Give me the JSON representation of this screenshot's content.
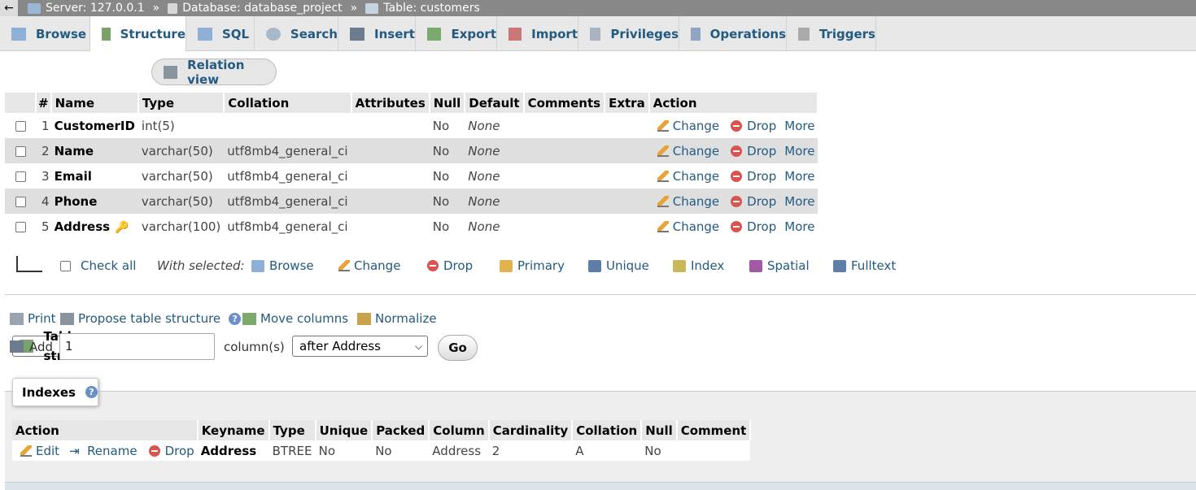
{
  "breadcrumb": {
    "back": "←",
    "server": "Server: 127.0.0.1",
    "database": "Database: database_project",
    "table": "Table: customers",
    "separator": "»"
  },
  "tabs": [
    {
      "label": "Browse",
      "icon": "browse-icon"
    },
    {
      "label": "Structure",
      "icon": "structure-icon",
      "active": true
    },
    {
      "label": "SQL",
      "icon": "sql-icon"
    },
    {
      "label": "Search",
      "icon": "search-icon"
    },
    {
      "label": "Insert",
      "icon": "insert-icon"
    },
    {
      "label": "Export",
      "icon": "export-icon"
    },
    {
      "label": "Import",
      "icon": "import-icon"
    },
    {
      "label": "Privileges",
      "icon": "privileges-icon"
    },
    {
      "label": "Operations",
      "icon": "wrench-icon"
    },
    {
      "label": "Triggers",
      "icon": "triggers-icon"
    }
  ],
  "subtabs": {
    "table_structure": "Table structure",
    "relation_view": "Relation view"
  },
  "structure": {
    "headers": [
      "#",
      "Name",
      "Type",
      "Collation",
      "Attributes",
      "Null",
      "Default",
      "Comments",
      "Extra",
      "Action"
    ],
    "rows": [
      {
        "num": "1",
        "name": "CustomerID",
        "type": "int(5)",
        "collation": "",
        "null": "No",
        "default": "None"
      },
      {
        "num": "2",
        "name": "Name",
        "type": "varchar(50)",
        "collation": "utf8mb4_general_ci",
        "null": "No",
        "default": "None"
      },
      {
        "num": "3",
        "name": "Email",
        "type": "varchar(50)",
        "collation": "utf8mb4_general_ci",
        "null": "No",
        "default": "None"
      },
      {
        "num": "4",
        "name": "Phone",
        "type": "varchar(50)",
        "collation": "utf8mb4_general_ci",
        "null": "No",
        "default": "None"
      },
      {
        "num": "5",
        "name": "Address",
        "type": "varchar(100)",
        "collation": "utf8mb4_general_ci",
        "null": "No",
        "default": "None"
      }
    ],
    "actions": {
      "change": "Change",
      "drop": "Drop",
      "more": "More"
    }
  },
  "with_selected": {
    "check_all": "Check all",
    "label": "With selected:",
    "items": [
      "Browse",
      "Change",
      "Drop",
      "Primary",
      "Unique",
      "Index",
      "Spatial",
      "Fulltext"
    ]
  },
  "tools": {
    "print": "Print",
    "propose": "Propose table structure",
    "move_columns": "Move columns",
    "normalize": "Normalize"
  },
  "add_column": {
    "label": "Add",
    "value": "1",
    "suffix": "column(s)",
    "position": "after Address",
    "go": "Go"
  },
  "indexes": {
    "title": "Indexes",
    "headers": [
      "Action",
      "Keyname",
      "Type",
      "Unique",
      "Packed",
      "Column",
      "Cardinality",
      "Collation",
      "Null",
      "Comment"
    ],
    "row": {
      "edit": "Edit",
      "rename": "Rename",
      "drop": "Drop",
      "keyname": "Address",
      "type": "BTREE",
      "unique": "No",
      "packed": "No",
      "column": "Address",
      "cardinality": "2",
      "collation": "A",
      "null": "No",
      "comment": ""
    }
  }
}
